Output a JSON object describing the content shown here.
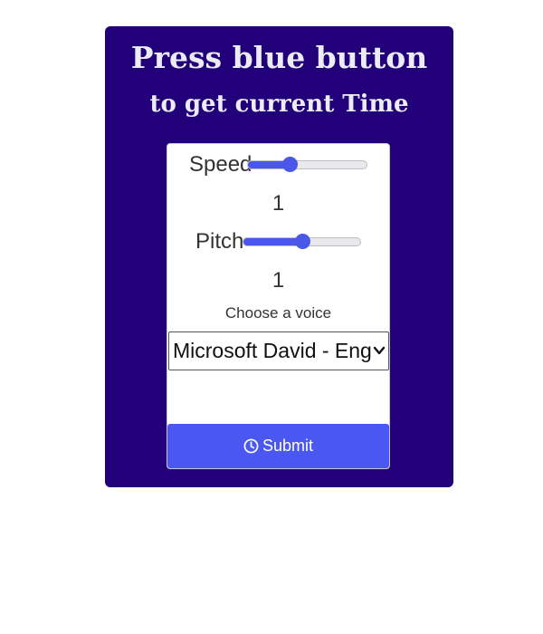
{
  "header": {
    "title": "Press blue button",
    "subtitle": "to get current Time"
  },
  "speed": {
    "label": "Speed",
    "value": "1",
    "level": 0.35
  },
  "pitch": {
    "label": "Pitch",
    "value": "1",
    "level": 0.5
  },
  "voice": {
    "label": "Choose a voice",
    "selected": "Microsoft David - English (United States)"
  },
  "submit": {
    "label": "Submit",
    "icon": "clock-icon"
  },
  "colors": {
    "card_background": "#220079",
    "accent": "#4a57f0"
  }
}
